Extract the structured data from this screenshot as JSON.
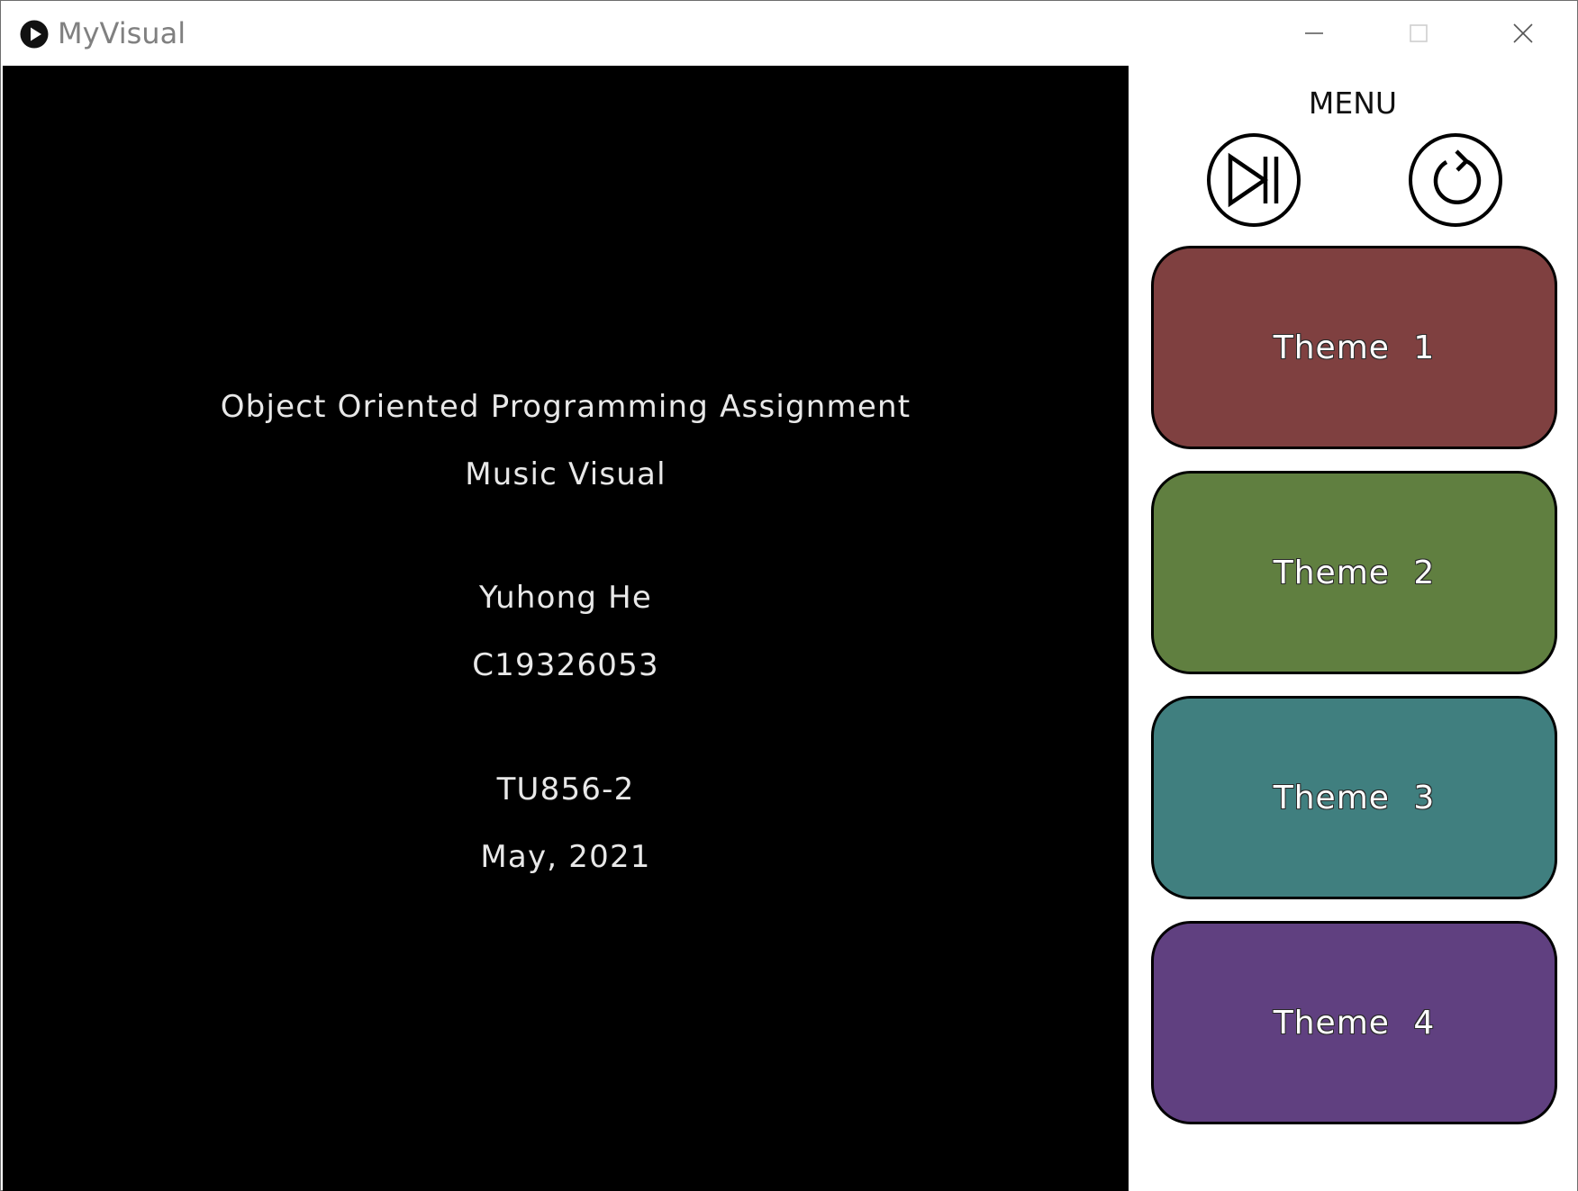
{
  "window": {
    "title": "MyVisual",
    "app_icon": "play-circle-icon",
    "controls": [
      "minimize-icon",
      "maximize-icon",
      "close-icon"
    ]
  },
  "canvas": {
    "background": "#000000",
    "lines": [
      "Object Oriented Programming Assignment",
      "Music Visual",
      "Yuhong He",
      "C19326053",
      "TU856-2",
      "May, 2021"
    ]
  },
  "menu": {
    "title": "MENU",
    "play_pause_icon": "play-pause-icon",
    "restart_icon": "restart-icon",
    "themes": [
      {
        "label": "Theme  1",
        "color": "#7f4040"
      },
      {
        "label": "Theme  2",
        "color": "#607f40"
      },
      {
        "label": "Theme  3",
        "color": "#407f7f"
      },
      {
        "label": "Theme  4",
        "color": "#604080"
      }
    ]
  }
}
